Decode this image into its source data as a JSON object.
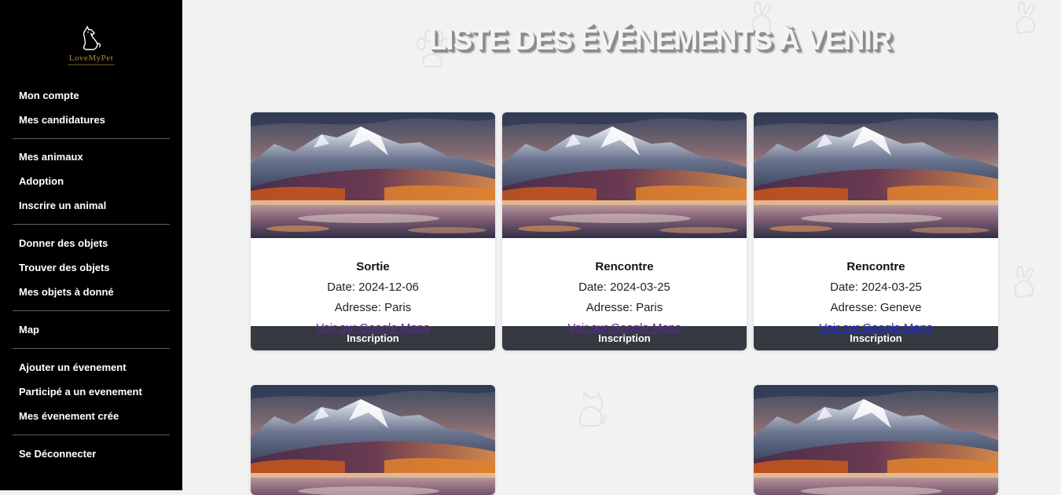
{
  "brand": {
    "name": "LoveMyPet"
  },
  "sidebar": {
    "groups": [
      [
        "Mon compte",
        "Mes candidatures"
      ],
      [
        "Mes animaux",
        "Adoption",
        "Inscrire un animal"
      ],
      [
        "Donner des objets",
        "Trouver des objets",
        "Mes objets à donné"
      ],
      [
        "Map"
      ],
      [
        "Ajouter un évenement",
        "Participé a un evenement",
        "Mes évenement crée"
      ],
      [
        "Se Déconnecter"
      ]
    ]
  },
  "main": {
    "title": "LISTE DES ÉVÉNEMENTS À VENIR",
    "events": [
      {
        "title": "Sortie",
        "date": "Date: 2024-12-06",
        "address": "Adresse: Paris",
        "link": "Voir sur Google Maps",
        "link_state": "visited",
        "button": "Inscription"
      },
      {
        "title": "Rencontre",
        "date": "Date: 2024-03-25",
        "address": "Adresse: Paris",
        "link": "Voir sur Google Maps",
        "link_state": "visited",
        "button": "Inscription"
      },
      {
        "title": "Rencontre",
        "date": "Date: 2024-03-25",
        "address": "Adresse: Geneve",
        "link": "Voir sur Google Maps",
        "link_state": "unvisited",
        "button": "Inscription"
      }
    ]
  },
  "colors": {
    "sidebar_bg": "#000000",
    "page_bg": "#f2f2f2",
    "button_bg": "#343a40",
    "link_visited": "#5a2c8a",
    "link_unvisited": "#2a2ad0",
    "logo_gold": "#b08a3e"
  },
  "icons": [
    "dog-logo-icon",
    "paw-print-icon",
    "cat-icon",
    "rabbit-icon"
  ]
}
